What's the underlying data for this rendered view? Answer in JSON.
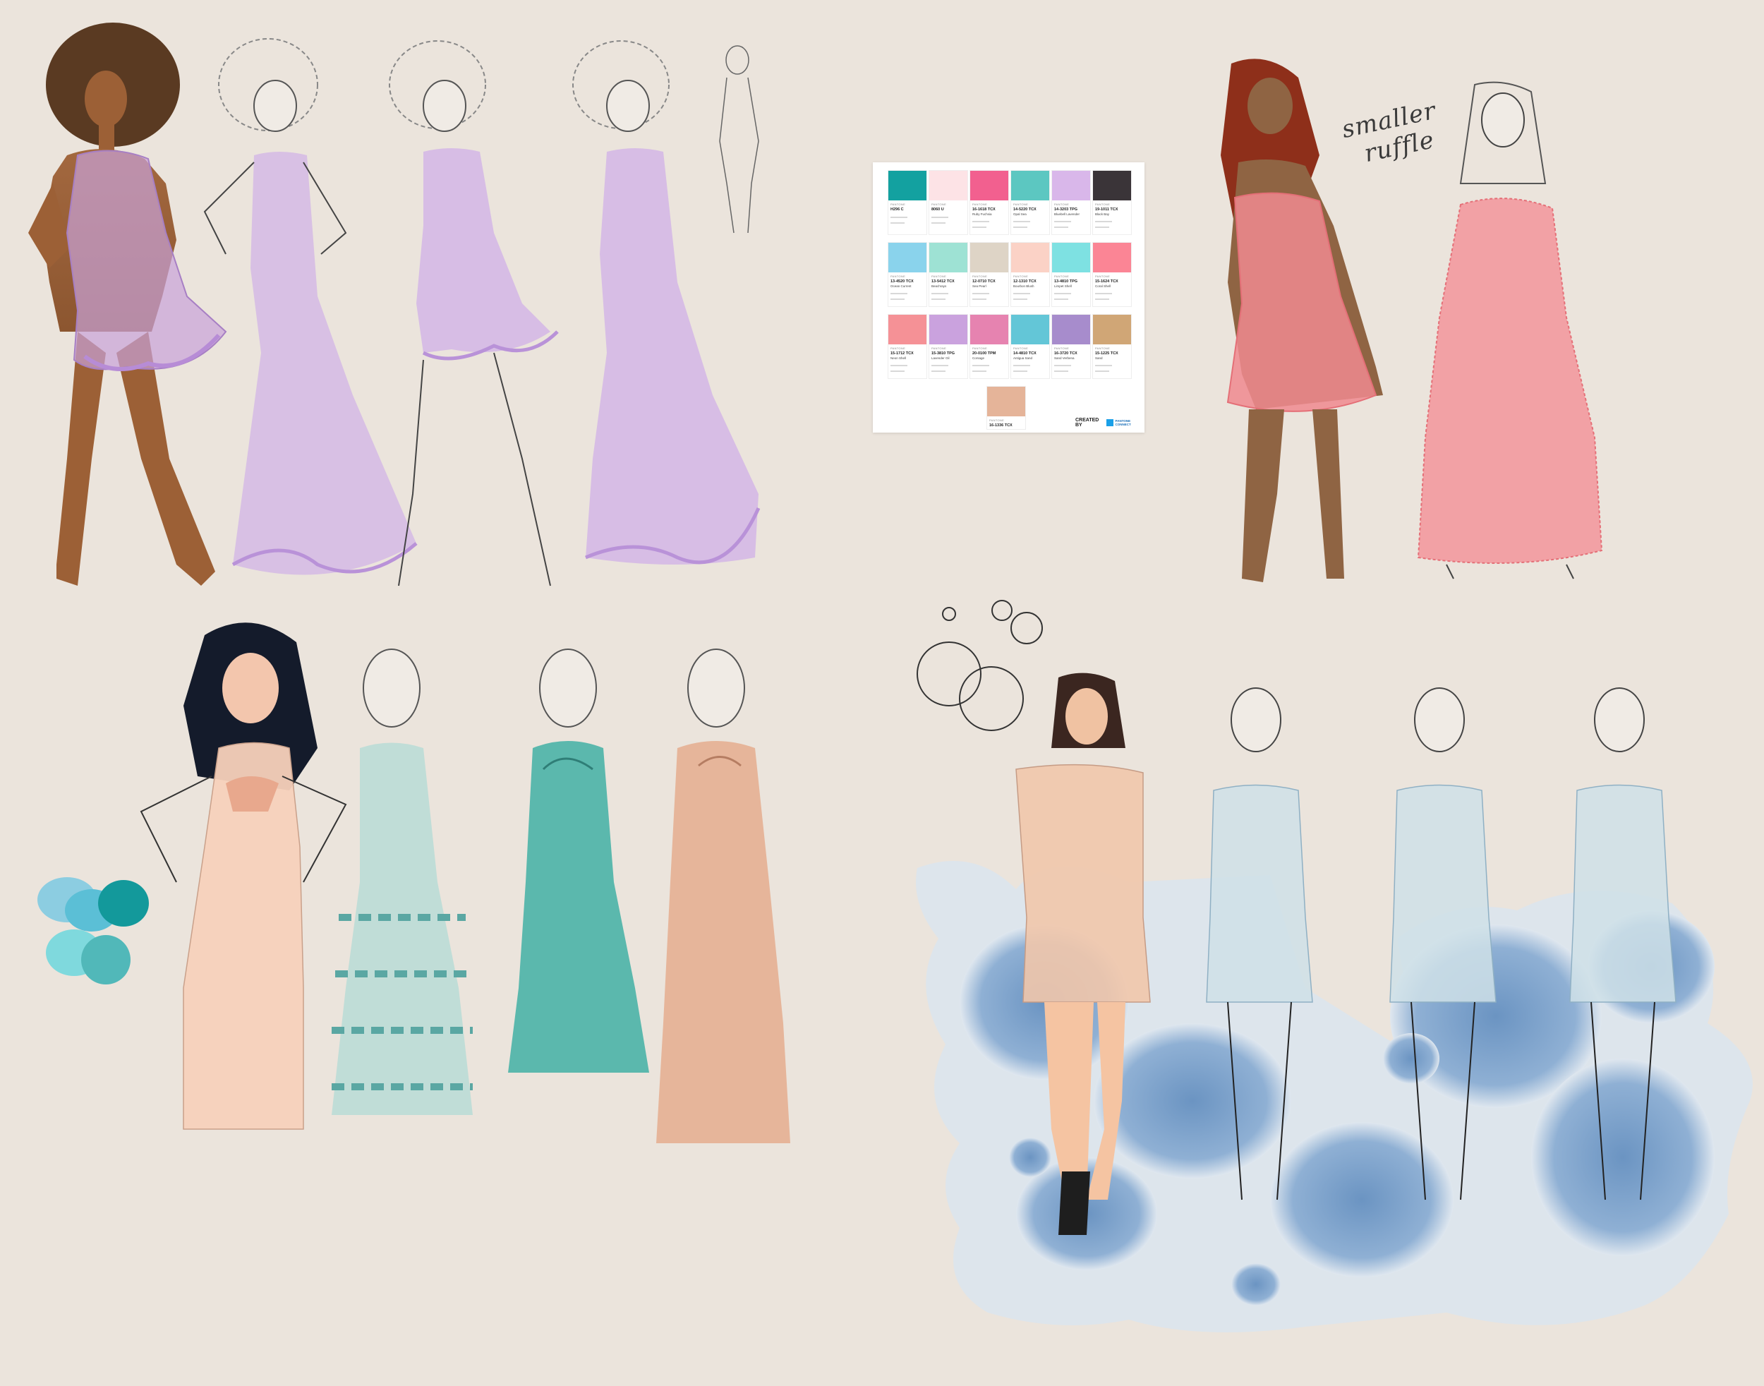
{
  "canvas": {
    "background": "#ebe4dc"
  },
  "annotation": {
    "line1": "smaller",
    "line2": "ruffle"
  },
  "palette": {
    "brand_label": "PANTONE",
    "created_by": "CREATED BY",
    "created_brand": "PANTONE CONNECT",
    "swatches": [
      {
        "color": "#13a1a0",
        "code": "H296 C",
        "name": ""
      },
      {
        "color": "#fde3e6",
        "code": "8060 U",
        "name": ""
      },
      {
        "color": "#f2608f",
        "code": "16-1618 TCX",
        "name": "Ruby Fuchsia"
      },
      {
        "color": "#5cc7c1",
        "code": "14-5220 TCX",
        "name": "Opal Sea"
      },
      {
        "color": "#d9b7ea",
        "code": "14-3203 TPG",
        "name": "Bluebell Lavender"
      },
      {
        "color": "#3a3438",
        "code": "19-1011 TCX",
        "name": "Black Bay"
      },
      {
        "color": "#8ad3ec",
        "code": "13-4520 TCX",
        "name": "Ocean Current"
      },
      {
        "color": "#9ee2d4",
        "code": "13-5412 TCX",
        "name": "Beachrays"
      },
      {
        "color": "#ded4c6",
        "code": "12-0710 TCX",
        "name": "Sea Pearl"
      },
      {
        "color": "#fbd2c6",
        "code": "12-1310 TCX",
        "name": "Bourbon Blush"
      },
      {
        "color": "#7ee1e2",
        "code": "13-4810 TPG",
        "name": "Limpet Shell"
      },
      {
        "color": "#fb8595",
        "code": "15-1624 TCX",
        "name": "Coral Shell"
      },
      {
        "color": "#f59196",
        "code": "15-1712 TCX",
        "name": "Neon Shell"
      },
      {
        "color": "#caa2de",
        "code": "15-3810 TPG",
        "name": "Lavender Oil"
      },
      {
        "color": "#e683b0",
        "code": "20-0100 TPM",
        "name": "Corsage"
      },
      {
        "color": "#63c6d7",
        "code": "14-4810 TCX",
        "name": "Antigua Sand"
      },
      {
        "color": "#a78ccc",
        "code": "16-3720 TCX",
        "name": "Sand Verbena"
      },
      {
        "color": "#d0a676",
        "code": "15-1225 TCX",
        "name": "Sand"
      },
      {
        "color": "#e5b499",
        "code": "16-1336 TCX",
        "name": ""
      }
    ]
  }
}
